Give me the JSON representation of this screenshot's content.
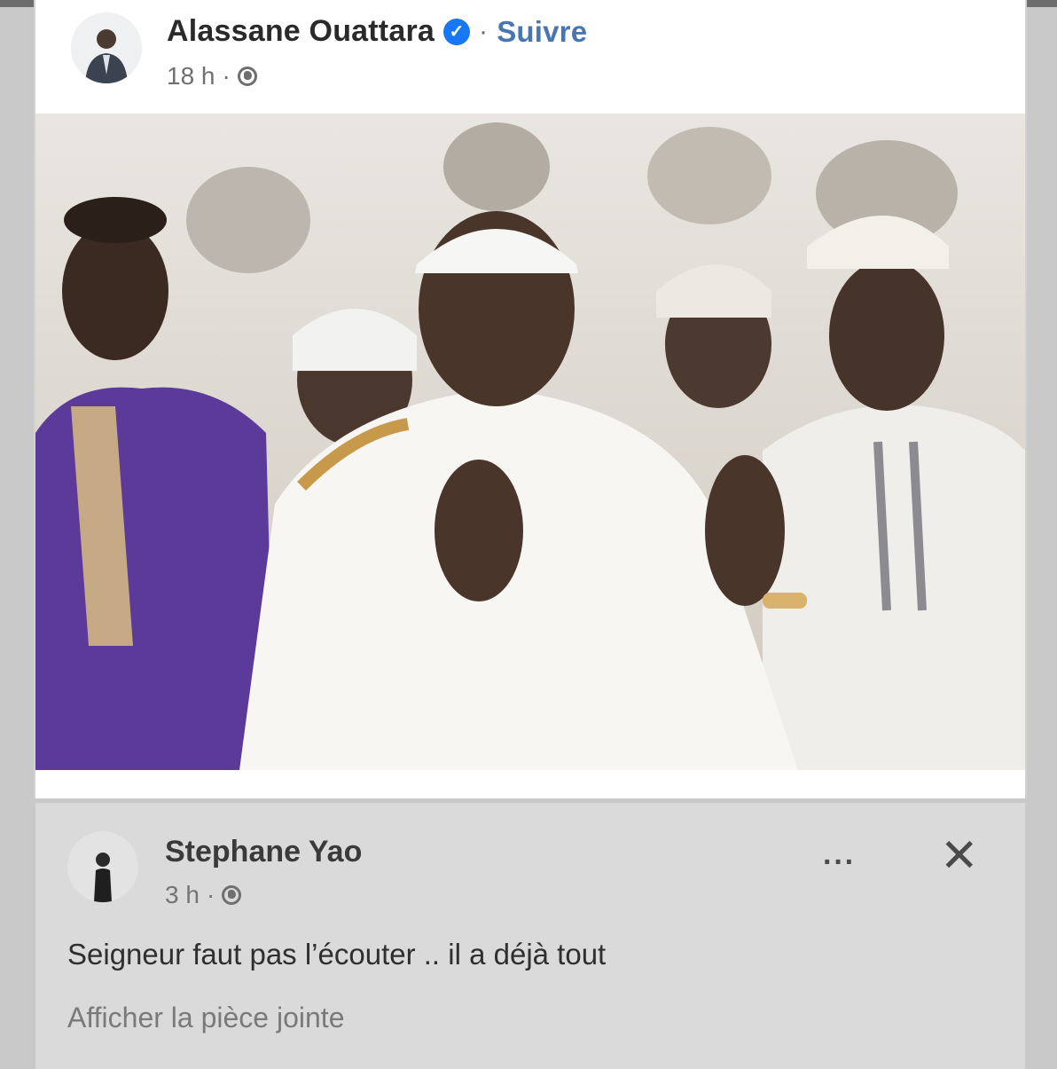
{
  "post": {
    "author": "Alassane Ouattara",
    "verified_icon": "verified-check-icon",
    "separator": "·",
    "follow_label": "Suivre",
    "time": "18 h",
    "meta_separator": "·",
    "audience_icon": "globe-icon",
    "photo_subject": "photo",
    "caption_emojis": [
      "🤣",
      "🤣",
      "🤣",
      "🤣",
      "🤣",
      "🤣",
      "🤣",
      "🤣",
      "🤣",
      "🤣",
      "🤣"
    ]
  },
  "comment": {
    "author": "Stephane Yao",
    "time": "3 h",
    "meta_separator": "·",
    "audience_icon": "globe-icon",
    "more_icon": "more-options-icon",
    "more_label": "···",
    "close_icon": "close-icon",
    "close_label": "✕",
    "text": "Seigneur faut pas l’écouter .. il a déjà tout",
    "attachment_label": "Afficher la pièce jointe"
  },
  "colors": {
    "page_bg": "#c9c9c9",
    "card_bg": "#ffffff",
    "comment_bg": "#dadada",
    "follow_link": "#4a76b0",
    "verified": "#1877f2",
    "caption_bar": "#2d2d2d"
  }
}
